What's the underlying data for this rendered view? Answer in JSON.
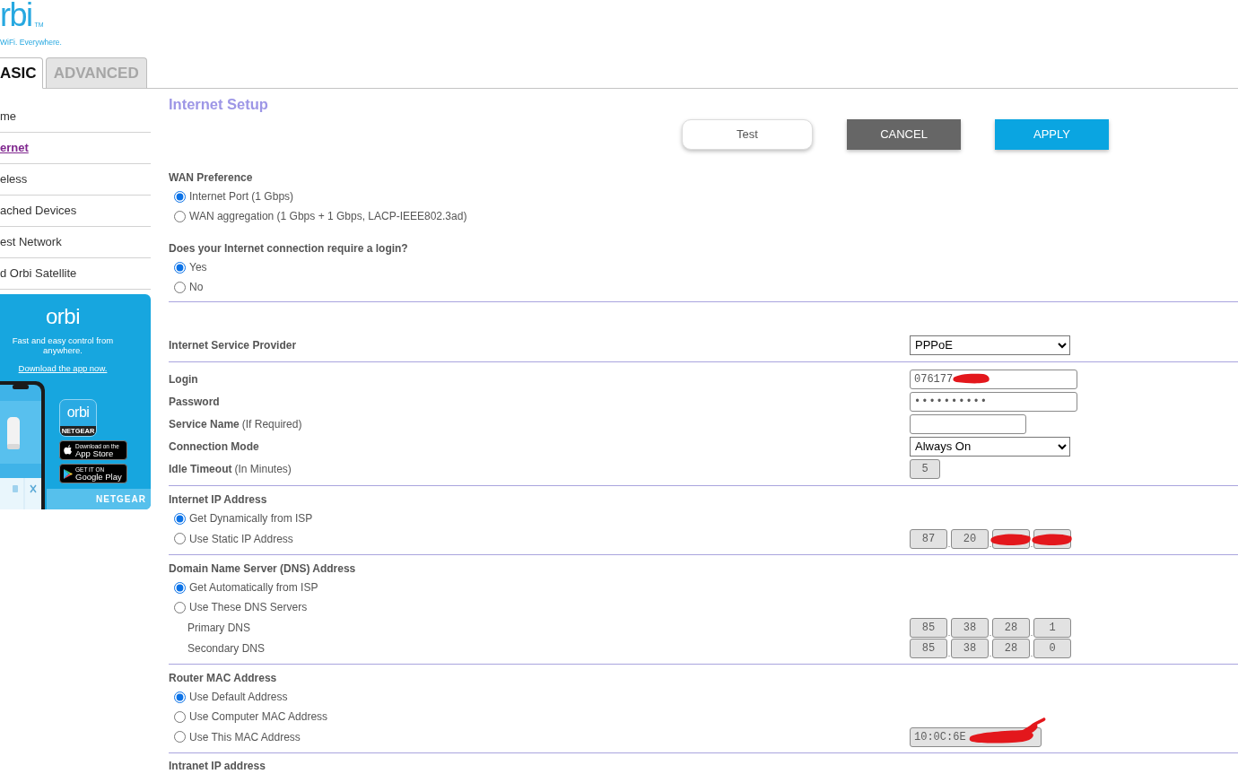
{
  "logo": {
    "wordmark": "rbi",
    "trademark": "TM",
    "tagline": "WiFi. Everywhere."
  },
  "tabs": [
    {
      "label": "ASIC",
      "selected": true
    },
    {
      "label": "ADVANCED",
      "selected": false
    }
  ],
  "sidebar": {
    "items": [
      {
        "label": "me",
        "selected": false
      },
      {
        "label": "ernet",
        "selected": true
      },
      {
        "label": "eless",
        "selected": false
      },
      {
        "label": "ached Devices",
        "selected": false
      },
      {
        "label": "est Network",
        "selected": false
      },
      {
        "label": "d Orbi Satellite",
        "selected": false
      }
    ]
  },
  "promo": {
    "logo": "orbi",
    "text": "Fast and easy control from anywhere.",
    "link": "Download the app now.",
    "app_icon": {
      "wordmark": "orbi",
      "label": "NETGEAR"
    },
    "badges": [
      {
        "kind": "apple",
        "caption": "Download on the",
        "store": "App Store"
      },
      {
        "kind": "google",
        "caption": "GET IT ON",
        "store": "Google Play"
      }
    ],
    "footer": "NETGEAR"
  },
  "page": {
    "title": "Internet Setup",
    "buttons": [
      {
        "label": "Test",
        "kind": "outline"
      },
      {
        "label": "CANCEL",
        "kind": "secondary"
      },
      {
        "label": "APPLY",
        "kind": "primary"
      }
    ]
  },
  "sections": [
    {
      "rows": [
        {
          "kind": "heading",
          "text": "WAN Preference"
        },
        {
          "kind": "radio",
          "label": "Internet Port (1 Gbps)",
          "selected": true
        },
        {
          "kind": "radio",
          "label": "WAN aggregation (1 Gbps + 1 Gbps, LACP-IEEE802.3ad)",
          "selected": false
        },
        {
          "kind": "heading",
          "text": "Does your Internet connection require a login?"
        },
        {
          "kind": "radio",
          "label": "Yes",
          "selected": true
        },
        {
          "kind": "radio",
          "label": "No",
          "selected": false
        }
      ]
    },
    {
      "rows": [
        {
          "kind": "field",
          "label": "Internet Service Provider",
          "control": {
            "kind": "select",
            "value": "PPPoE"
          }
        }
      ]
    },
    {
      "rows": [
        {
          "kind": "field",
          "label": "Login",
          "control": {
            "kind": "text",
            "value": "076177",
            "disabled": false,
            "redacted": true
          }
        },
        {
          "kind": "field",
          "label": "Password",
          "control": {
            "kind": "password",
            "value": "••••••••••",
            "disabled": false
          }
        },
        {
          "kind": "field",
          "label": "Service Name",
          "hint": "(If Required)",
          "control": {
            "kind": "short-text",
            "disabled": false
          }
        },
        {
          "kind": "field",
          "label": "Connection Mode",
          "control": {
            "kind": "select",
            "value": "Always On"
          }
        },
        {
          "kind": "field",
          "label": "Idle Timeout",
          "hint": "(In Minutes)",
          "control": {
            "kind": "number",
            "value": "5",
            "disabled": true
          }
        }
      ]
    },
    {
      "rows": [
        {
          "kind": "heading",
          "text": "Internet IP Address"
        },
        {
          "kind": "radio",
          "label": "Get Dynamically from ISP",
          "selected": true
        },
        {
          "kind": "radio",
          "label": "Use Static IP Address",
          "selected": false,
          "control": {
            "kind": "ip",
            "disabled": true,
            "separator": ".",
            "octets": [
              {
                "value": "87"
              },
              {
                "value": "20"
              },
              {
                "redacted": true
              },
              {
                "redacted": true
              }
            ]
          }
        }
      ]
    },
    {
      "rows": [
        {
          "kind": "heading",
          "text": "Domain Name Server (DNS) Address"
        },
        {
          "kind": "radio",
          "label": "Get Automatically from ISP",
          "selected": true
        },
        {
          "kind": "radio",
          "label": "Use These DNS Servers",
          "selected": false
        },
        {
          "kind": "subfield",
          "label": "Primary DNS",
          "control": {
            "kind": "ip",
            "disabled": true,
            "separator": ".",
            "octets": [
              {
                "value": "85"
              },
              {
                "value": "38"
              },
              {
                "value": "28"
              },
              {
                "value": "1"
              }
            ]
          }
        },
        {
          "kind": "subfield",
          "label": "Secondary DNS",
          "control": {
            "kind": "ip",
            "disabled": true,
            "separator": ".",
            "octets": [
              {
                "value": "85"
              },
              {
                "value": "38"
              },
              {
                "value": "28"
              },
              {
                "value": "0"
              }
            ]
          }
        }
      ]
    },
    {
      "rows": [
        {
          "kind": "heading",
          "text": "Router MAC Address"
        },
        {
          "kind": "radio",
          "label": "Use Default Address",
          "selected": true
        },
        {
          "kind": "radio",
          "label": "Use Computer MAC Address",
          "selected": false
        },
        {
          "kind": "radio",
          "label": "Use This MAC Address",
          "selected": false,
          "control": {
            "kind": "mac",
            "value": "10:0C:6E",
            "disabled": true,
            "redacted": true
          }
        }
      ]
    },
    {
      "rows": [
        {
          "kind": "heading",
          "text": "Intranet IP address"
        }
      ]
    }
  ]
}
